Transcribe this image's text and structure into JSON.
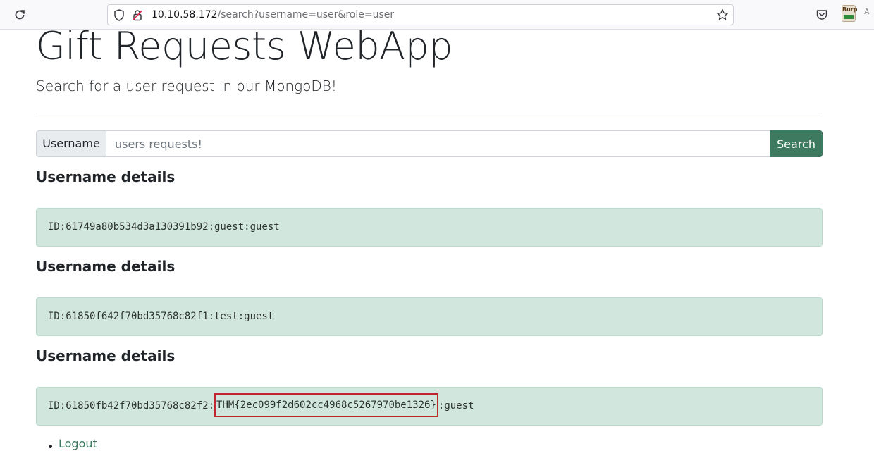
{
  "browser": {
    "url_host": "10.10.58.172",
    "url_path": "/search?username=user&role=user",
    "reload_icon": "reload-icon",
    "shield_icon": "tracking-protection-icon",
    "lock_icon": "insecure-lock-icon",
    "star_icon": "bookmark-star-icon",
    "pocket_icon": "pocket-icon",
    "burp_icon": "burp-extension-icon",
    "burp_label": "Burp",
    "translate_icon": "translate-icon",
    "translate_label": "A"
  },
  "page": {
    "title": "Gift Requests WebApp",
    "lead": "Search for a user request in our MongoDB!"
  },
  "search": {
    "label": "Username",
    "placeholder": "users requests!",
    "value": "",
    "button_label": "Search"
  },
  "results": [
    {
      "heading": "Username details",
      "prefix": "ID:61749a80b534d3a130391b92:guest:guest",
      "flag": "",
      "suffix": ""
    },
    {
      "heading": "Username details",
      "prefix": "ID:61850f642f70bd35768c82f1:test:guest",
      "flag": "",
      "suffix": ""
    },
    {
      "heading": "Username details",
      "prefix": "ID:61850fb42f70bd35768c82f2:",
      "flag": "THM{2ec099f2d602cc4968c5267970be1326}",
      "suffix": ":guest"
    }
  ],
  "nav": {
    "logout_label": "Logout"
  },
  "colors": {
    "accent": "#3d7a5f",
    "alert_bg": "#d1e7dd",
    "highlight_box": "#c0262b"
  }
}
